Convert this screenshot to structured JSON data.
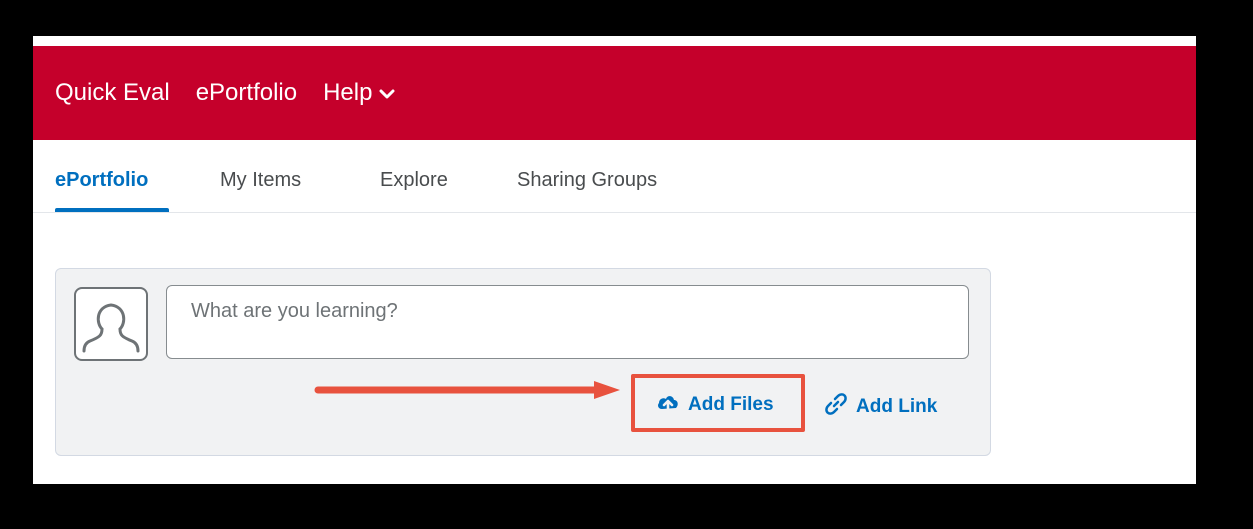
{
  "navbar": {
    "items": [
      {
        "label": "Quick Eval"
      },
      {
        "label": "ePortfolio"
      },
      {
        "label": "Help"
      }
    ],
    "background": "#c5002b"
  },
  "tabs": [
    {
      "label": "ePortfolio",
      "active": true
    },
    {
      "label": "My Items",
      "active": false
    },
    {
      "label": "Explore",
      "active": false
    },
    {
      "label": "Sharing Groups",
      "active": false
    }
  ],
  "composer": {
    "placeholder": "What are you learning?",
    "add_files_label": "Add Files",
    "add_link_label": "Add Link"
  },
  "colors": {
    "accent": "#006fbf",
    "annotation": "#e8523e"
  },
  "icons": [
    "chevron-down-icon",
    "user-avatar-icon",
    "cloud-upload-icon",
    "link-icon"
  ]
}
